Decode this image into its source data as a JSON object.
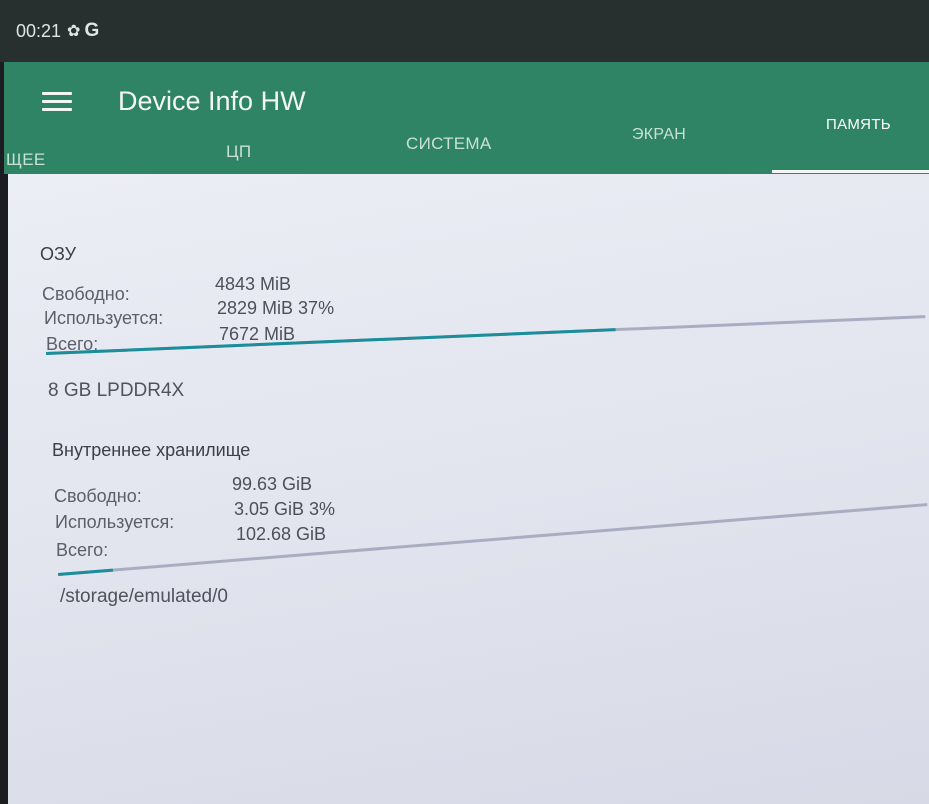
{
  "status_bar": {
    "time": "00:21",
    "gear_icon": "gear-icon",
    "g_label": "G"
  },
  "app_bar": {
    "title": "Device Info HW",
    "menu_icon": "hamburger-menu-icon"
  },
  "tabs": [
    {
      "label": "ЩЕЕ",
      "active": false
    },
    {
      "label": "ЦП",
      "active": false
    },
    {
      "label": "СИСТЕМА",
      "active": false
    },
    {
      "label": "ЭКРАН",
      "active": false
    },
    {
      "label": "ПАМЯТЬ",
      "active": true
    }
  ],
  "ram": {
    "title": "ОЗУ",
    "free_label": "Свободно:",
    "free_value": "4843 MiB",
    "used_label": "Используется:",
    "used_value": "2829 MiB 37%",
    "total_label": "Всего:",
    "total_value": "7672 MiB",
    "used_fraction": 0.37,
    "type": "8 GB LPDDR4X"
  },
  "storage": {
    "title": "Внутреннее хранилище",
    "free_label": "Свободно:",
    "free_value": "99.63 GiB",
    "used_label": "Используется:",
    "used_value": "3.05 GiB 3%",
    "total_label": "Всего:",
    "total_value": "102.68 GiB",
    "used_fraction": 0.03,
    "path": "/storage/emulated/0"
  },
  "colors": {
    "app_bar": "#2f8466",
    "progress_fill": "#1b8d9b",
    "progress_track": "#a9adc2"
  }
}
